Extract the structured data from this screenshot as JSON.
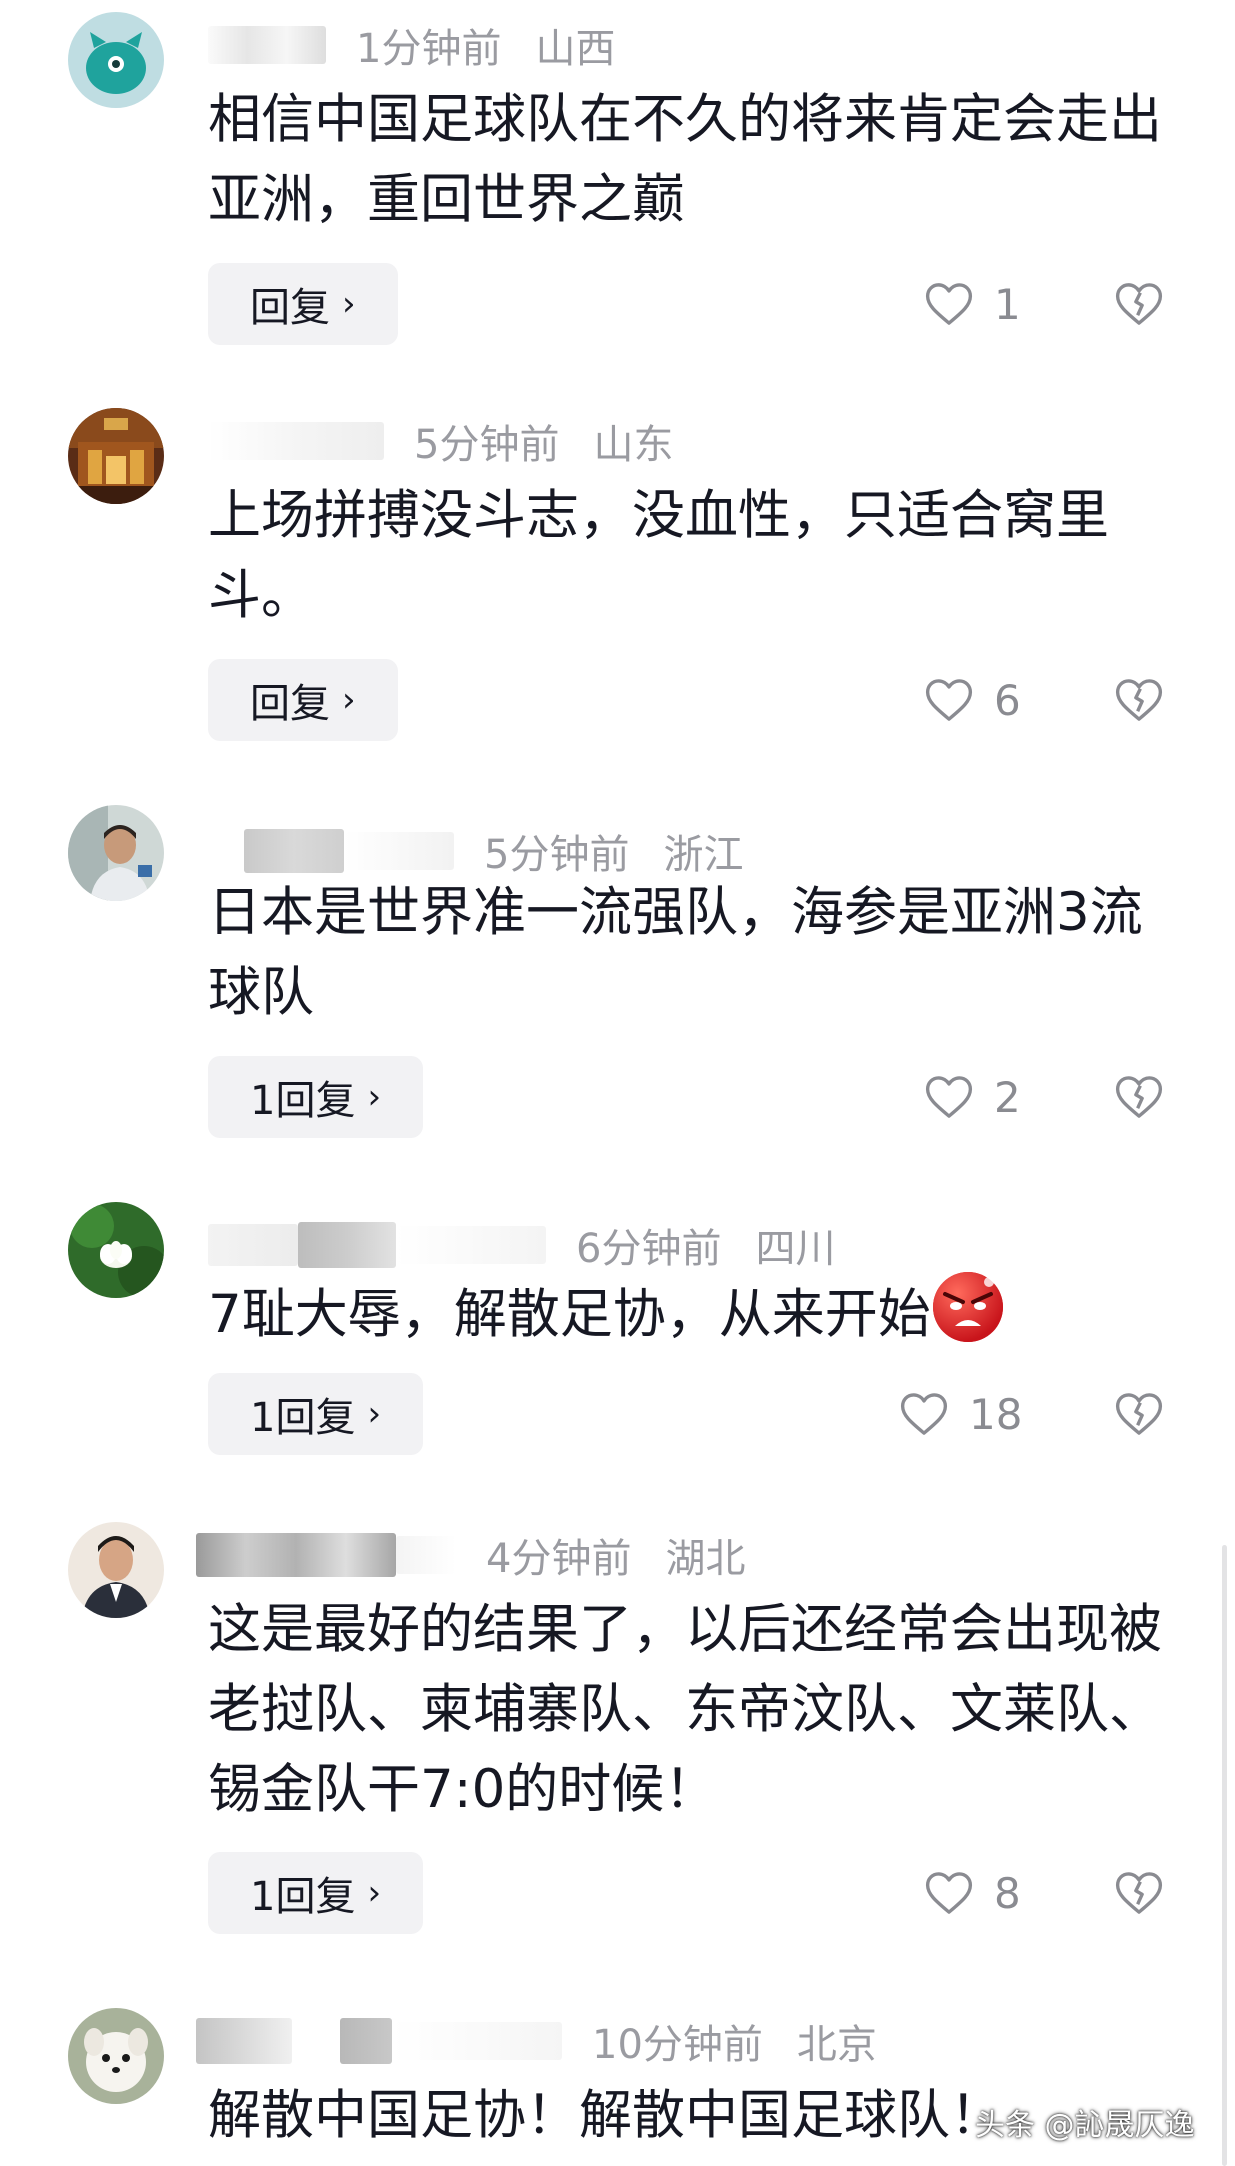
{
  "comments": [
    {
      "time": "1分钟前",
      "region": "山西",
      "text": "相信中国足球队在不久的将来肯定会走出亚洲，重回世界之巅",
      "reply_label": "回复",
      "likes": "1",
      "avatar": "teal-monster-avatar"
    },
    {
      "time": "5分钟前",
      "region": "山东",
      "text": "上场拼搏没斗志，没血性，只适合窝里斗。",
      "reply_label": "回复",
      "likes": "6",
      "avatar": "palace-scene-avatar"
    },
    {
      "time": "5分钟前",
      "region": "浙江",
      "text": "日本是世界准一流强队，海参是亚洲3流球队",
      "reply_label": "1回复",
      "likes": "2",
      "avatar": "man-photo-avatar"
    },
    {
      "time": "6分钟前",
      "region": "四川",
      "text": "7耻大辱，解散足协，从来开始",
      "emoji": "angry-face-emoji",
      "reply_label": "1回复",
      "likes": "18",
      "avatar": "lotus-flower-avatar"
    },
    {
      "time": "4分钟前",
      "region": "湖北",
      "text": "这是最好的结果了，以后还经常会出现被老挝队、柬埔寨队、东帝汶队、文莱队、锡金队干7:0的时候！",
      "reply_label": "1回复",
      "likes": "8",
      "avatar": "man-suit-avatar"
    },
    {
      "time": "10分钟前",
      "region": "北京",
      "text": "解散中国足协！解散中国足球队！",
      "avatar": "white-dog-avatar"
    }
  ],
  "watermark": "头条 @訫晟仄逸",
  "icons": {
    "like": "heart-outline-icon",
    "dislike": "broken-heart-icon",
    "chevron": "chevron-right-icon"
  },
  "colors": {
    "text": "#161823",
    "meta": "#9a9ba1",
    "reply_bg": "#f2f2f4",
    "icon": "#8a8b91"
  }
}
